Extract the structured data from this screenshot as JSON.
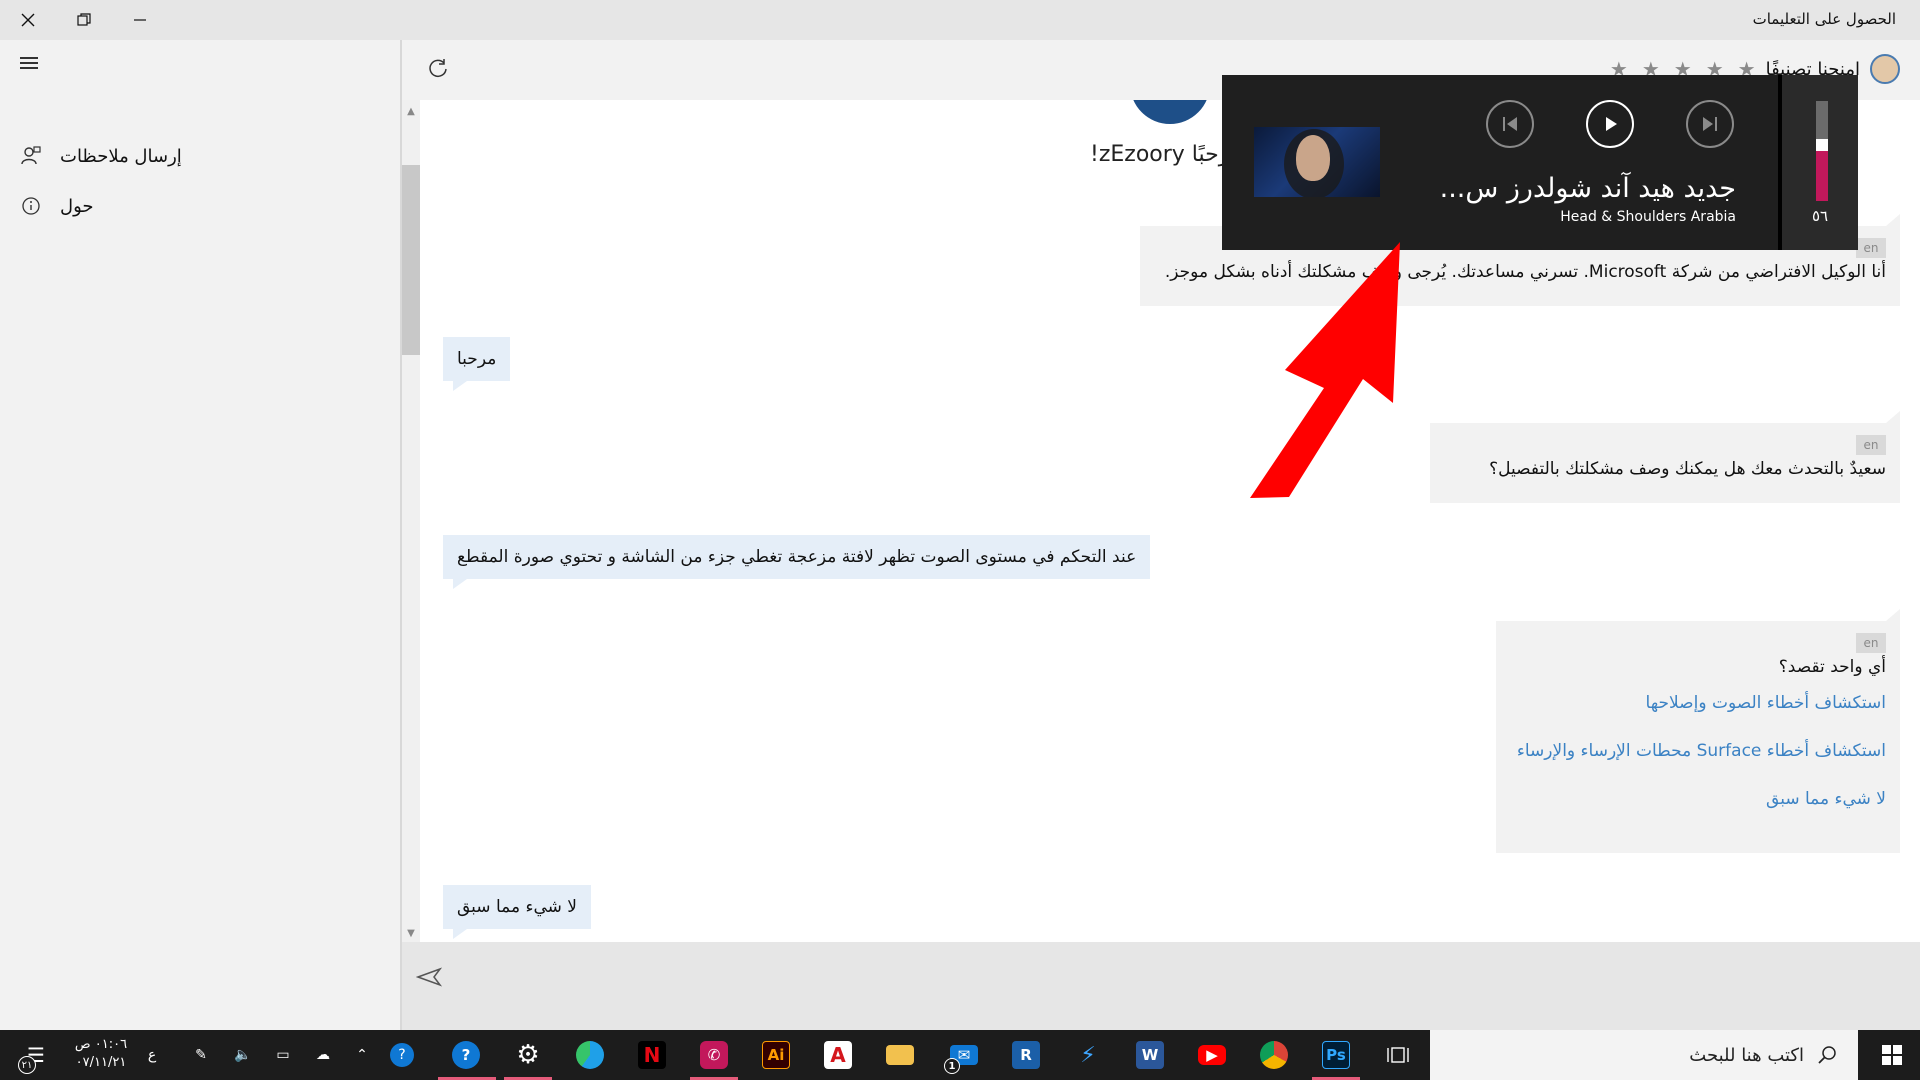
{
  "window": {
    "title": "الحصول على التعليمات"
  },
  "sidebar": {
    "items": [
      {
        "label": "إرسال ملاحظات",
        "icon": "feedback-person-icon"
      },
      {
        "label": "حول",
        "icon": "info-icon"
      }
    ]
  },
  "header": {
    "rating_label": "امنحنا تصنيفًا",
    "stars": 5
  },
  "chat": {
    "greeting": "مرحبًا zEzoory!",
    "messages": [
      {
        "role": "bot",
        "lang": "en",
        "text": "أنا الوكيل الافتراضي من شركة Microsoft. تسرني مساعدتك. يُرجى وصف مشكلتك أدناه بشكل موجز."
      },
      {
        "role": "user",
        "text": "مرحبا"
      },
      {
        "role": "bot",
        "lang": "en",
        "text": "سعيدٌ بالتحدث معك هل يمكنك وصف مشكلتك بالتفصيل؟"
      },
      {
        "role": "user",
        "text": "عند التحكم في مستوى الصوت تظهر لافتة مزعجة تغطي جزء من الشاشة و تحتوي صورة المقطع"
      },
      {
        "role": "bot",
        "lang": "en",
        "text": "أي واحد تقصد؟",
        "options": [
          "استكشاف أخطاء الصوت وإصلاحها",
          "استكشاف أخطاء Surface محطات الإرساء والإرساء",
          "لا شيء مما سبق"
        ]
      },
      {
        "role": "user",
        "text": "لا شيء مما سبق"
      }
    ]
  },
  "media": {
    "title": "جديد هيد آند شولدرز س...",
    "subtitle": "Head & Shoulders Arabia",
    "volume": "٥٦",
    "volume_level": 0.56
  },
  "taskbar": {
    "search_placeholder": "اكتب هنا للبحث",
    "clock_time": "٠١:٠٦ ص",
    "clock_date": "٠٧/١١/٢١",
    "lang": "ع",
    "notification_count": "٢١",
    "mail_badge": "1",
    "apps": [
      "task-view",
      "photoshop",
      "chrome",
      "youtube",
      "word",
      "vs-code",
      "revit",
      "mail",
      "file-explorer",
      "acrobat",
      "illustrator",
      "whatsapp",
      "netflix",
      "edge",
      "settings",
      "get-help"
    ]
  }
}
